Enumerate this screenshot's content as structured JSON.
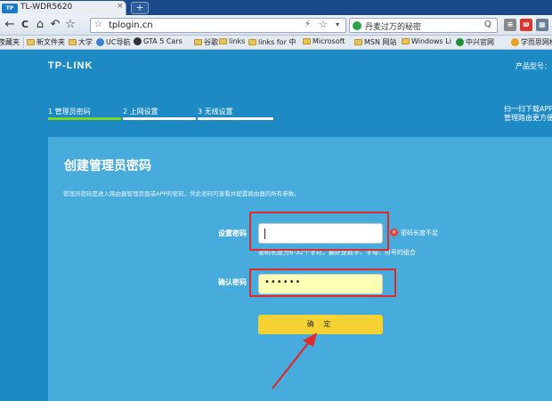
{
  "browser": {
    "tab_title": "TL-WDR5620",
    "tab_favicon": "TP",
    "tab_close": "×",
    "new_tab": "+",
    "nav_back": "←",
    "nav_forward": "⇦",
    "nav_reload": "C",
    "nav_home": "⌂",
    "nav_history": "↶",
    "nav_favorite": "☆",
    "url_icon": "☆",
    "url": "tplogin.cn",
    "url_flash": "⚡",
    "url_star": "☆",
    "url_dropdown": "▾",
    "search_text": "丹麦过万的秘密",
    "search_btn": "Q",
    "ext_1": "≡",
    "ext_2": "ϖ",
    "ext_3": "▦"
  },
  "bookmarks": [
    "夜藏夹",
    "新文件夹",
    "大学",
    "UC导航",
    "GTA 5 Cars",
    "谷歌",
    "links",
    "links for 中",
    "Microsoft",
    "MSN 网站",
    "Windows Li",
    "中兴官网",
    "学而思网校"
  ],
  "header": {
    "logo": "TP-LINK",
    "model_label": "产品型号：",
    "steps": [
      "1 管理员密码",
      "2 上网设置",
      "3 无线设置"
    ],
    "app_promo_line1": "扫一扫下载APP",
    "app_promo_line2": "管理路由更方便"
  },
  "form": {
    "title": "创建管理员密码",
    "description": "管理员密码是进入路由器管理页面或APP的密码，凭此密码可查看并配置路由器的所有参数。",
    "set_password_label": "设置密码",
    "confirm_password_label": "确认密码",
    "error_icon": "×",
    "error_text": "密码长度不足",
    "hint": "密码长度为6-32个字符，最好是数字、字母、符号的组合",
    "confirm_password_value": "••••••",
    "submit_label": "确 定"
  },
  "colors": {
    "page_bg": "#1e8ac3",
    "panel_bg": "#47abdb",
    "button": "#f4d233",
    "annotation": "#e0292b",
    "active_step": "#7fd321"
  }
}
